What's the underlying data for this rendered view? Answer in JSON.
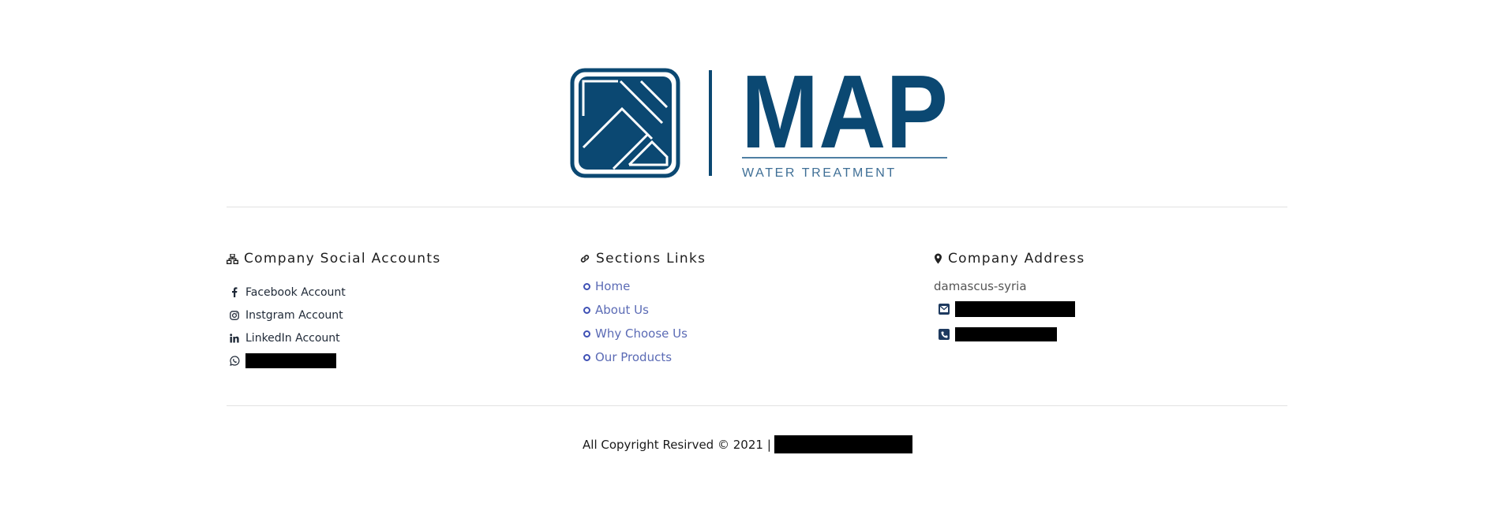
{
  "brand": {
    "name": "MAP",
    "tagline": "WATER TREATMENT",
    "color": "#0b4872",
    "logo_icon": "diamond-emblem-icon"
  },
  "social": {
    "title": "Company Social Accounts",
    "title_icon": "sitemap-icon",
    "items": [
      {
        "label": "Facebook Account",
        "icon": "facebook-icon"
      },
      {
        "label": "Instgram Account",
        "icon": "instagram-icon"
      },
      {
        "label": "LinkedIn Account",
        "icon": "linkedin-icon"
      }
    ],
    "whatsapp_icon": "whatsapp-icon"
  },
  "sections": {
    "title": "Sections Links",
    "title_icon": "link-icon",
    "links": [
      {
        "label": "Home"
      },
      {
        "label": "About Us"
      },
      {
        "label": "Why Choose Us"
      },
      {
        "label": "Our Products"
      }
    ],
    "link_color": "#5b6bb5"
  },
  "address": {
    "title": "Company Address",
    "title_icon": "map-marker-icon",
    "city": "damascus-syria",
    "email_icon": "envelope-icon",
    "phone_icon": "phone-icon"
  },
  "footer": {
    "copyright": "All Copyright Resirved © 2021",
    "separator": "|"
  }
}
